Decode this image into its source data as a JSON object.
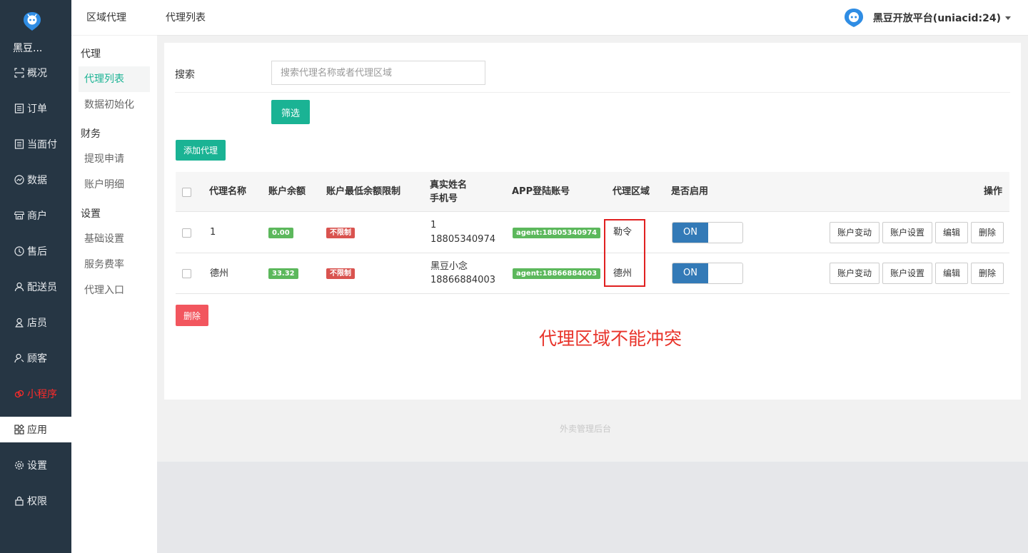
{
  "sidebar": {
    "brand": "黑豆...",
    "items": [
      {
        "label": "概况",
        "icon": "overview-icon"
      },
      {
        "label": "订单",
        "icon": "order-icon"
      },
      {
        "label": "当面付",
        "icon": "pay-icon"
      },
      {
        "label": "数据",
        "icon": "chart-icon"
      },
      {
        "label": "商户",
        "icon": "shop-icon"
      },
      {
        "label": "售后",
        "icon": "aftersale-icon"
      },
      {
        "label": "配送员",
        "icon": "courier-icon"
      },
      {
        "label": "店员",
        "icon": "clerk-icon"
      },
      {
        "label": "顾客",
        "icon": "customer-icon"
      },
      {
        "label": "小程序",
        "icon": "miniapp-icon"
      },
      {
        "label": "应用",
        "icon": "apps-icon"
      },
      {
        "label": "设置",
        "icon": "gear-icon"
      },
      {
        "label": "权限",
        "icon": "lock-icon"
      }
    ]
  },
  "subnav": {
    "header": "区域代理",
    "groups": {
      "agent": "代理",
      "finance": "财务",
      "settings": "设置"
    },
    "items": {
      "agent_list": "代理列表",
      "data_init": "数据初始化",
      "withdraw": "提现申请",
      "account_detail": "账户明细",
      "basic_settings": "基础设置",
      "service_rate": "服务费率",
      "agent_entry": "代理入口"
    }
  },
  "topbar": {
    "breadcrumb": "代理列表",
    "platform": "黑豆开放平台(uniacid:24)"
  },
  "filter": {
    "search_label": "搜索",
    "search_placeholder": "搜索代理名称或者代理区域",
    "search_value": "",
    "filter_button": "筛选"
  },
  "add_button": "添加代理",
  "table": {
    "headers": {
      "name": "代理名称",
      "balance": "账户余额",
      "min_limit": "账户最低余额限制",
      "realname": "真实姓名",
      "phone": "手机号",
      "app_account": "APP登陆账号",
      "region": "代理区域",
      "enabled": "是否启用",
      "actions": "操作"
    },
    "rows": [
      {
        "name": "1",
        "balance": "0.00",
        "limit": "不限制",
        "realname": "1",
        "phone": "18805340974",
        "account": "agent:18805340974",
        "region": "勒令",
        "enabled": "ON"
      },
      {
        "name": "德州",
        "balance": "33.32",
        "limit": "不限制",
        "realname": "黑豆小念",
        "phone": "18866884003",
        "account": "agent:18866884003",
        "region": "德州",
        "enabled": "ON"
      }
    ],
    "action_labels": {
      "change": "账户变动",
      "settings": "账户设置",
      "edit": "编辑",
      "delete": "删除"
    }
  },
  "bulk_delete": "删除",
  "annotation": "代理区域不能冲突",
  "footer": "外卖管理后台",
  "colors": {
    "accent": "#1ab394",
    "sidebar": "#263644",
    "danger": "#f2565e",
    "toggle_on": "#337ab7",
    "annotation": "#e8332a"
  }
}
